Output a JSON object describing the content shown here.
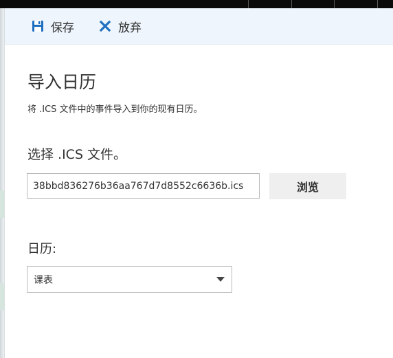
{
  "toolbar": {
    "save_label": "保存",
    "discard_label": "放弃",
    "save_icon": "save-icon",
    "discard_icon": "close-icon",
    "accent_color": "#1e6fbf"
  },
  "panel": {
    "title": "导入日历",
    "description": "将 .ICS 文件中的事件导入到你的现有日历。"
  },
  "file": {
    "label": "选择 .ICS 文件。",
    "value": "38bbd836276b36aa767d7d8552c6636b.ics",
    "browse_label": "浏览"
  },
  "calendar": {
    "label": "日历:",
    "selected": "课表"
  }
}
